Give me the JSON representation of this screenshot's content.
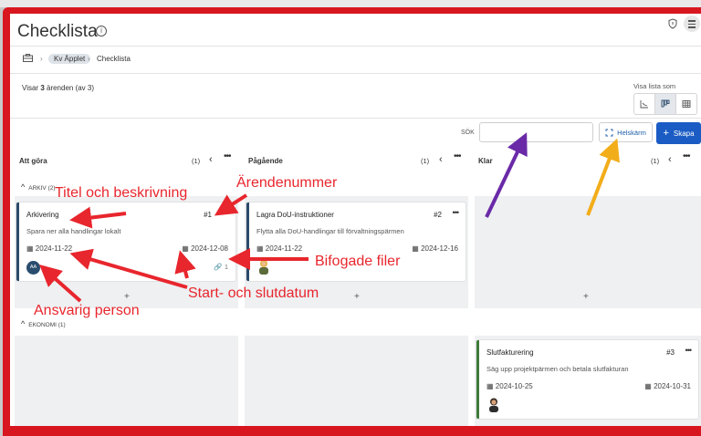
{
  "page": {
    "title": "Checklista",
    "breadcrumb": {
      "project": "Kv Äpplet",
      "current": "Checklista"
    },
    "count_prefix": "Visar ",
    "count_number": "3",
    "count_suffix": " ärenden (av 3)",
    "view_label": "Visa lista som"
  },
  "toolbar": {
    "search_label": "SÖK",
    "search_value": "",
    "fullscreen_label": "Helskärm",
    "create_label": "Skapa"
  },
  "columns": [
    {
      "title": "Att göra",
      "count": "(1)"
    },
    {
      "title": "Pågående",
      "count": "(1)"
    },
    {
      "title": "Klar",
      "count": "(1)"
    }
  ],
  "groups": [
    {
      "label": "ARKIV",
      "count": "(2)"
    },
    {
      "label": "EKONOMI",
      "count": "(1)"
    }
  ],
  "cards": [
    {
      "title": "Arkivering",
      "number": "#1",
      "description": "Spara ner alla handlingar lokalt",
      "start": "2024-11-22",
      "end": "2024-12-08",
      "assignee": "AA",
      "attachments": "1"
    },
    {
      "title": "Lagra DoU-instruktioner",
      "number": "#2",
      "description": "Flytta alla DoU-handlingar till förvaltningspärmen",
      "start": "2024-11-22",
      "end": "2024-12-16"
    },
    {
      "title": "Slutfakturering",
      "number": "#3",
      "description": "Säg upp projektpärmen och betala slutfakturan",
      "start": "2024-10-25",
      "end": "2024-10-31"
    }
  ],
  "annotations": {
    "title_desc": "Titel och beskrivning",
    "number": "Ärendenummer",
    "files": "Bifogade filer",
    "dates": "Start- och slutdatum",
    "person": "Ansvarig person"
  },
  "colors": {
    "accent": "#1b5cc4",
    "annotation": "#e8262d",
    "frame": "#d8161f",
    "purple_arrow": "#6a2aa8",
    "yellow_arrow": "#f2ad1a"
  }
}
